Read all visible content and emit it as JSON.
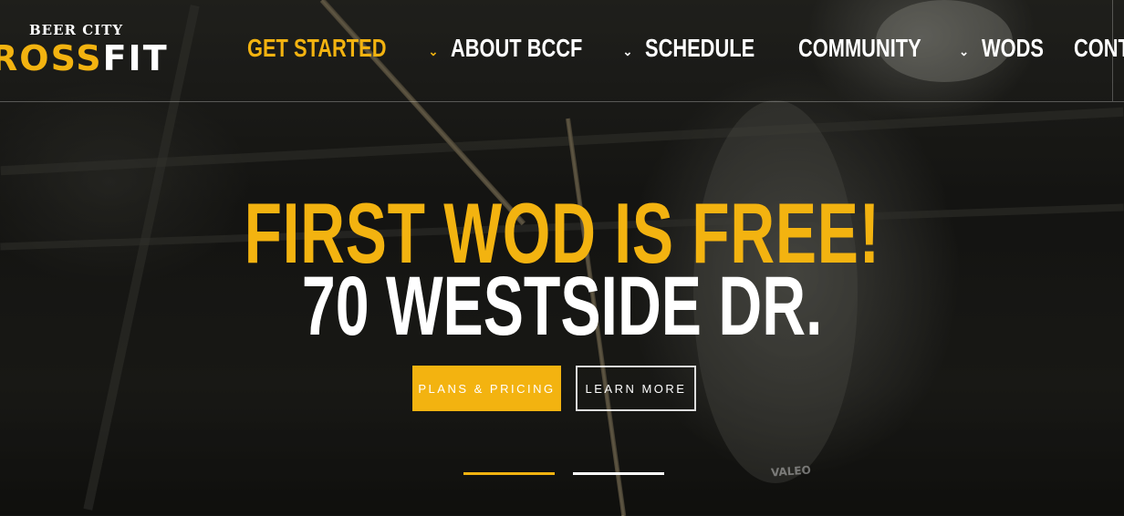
{
  "logo": {
    "top_text": "BEER CITY",
    "main_yellow": "ROSS",
    "main_white": "FIT",
    "icon": "barbell-skull-icon"
  },
  "nav": {
    "items": [
      {
        "label": "GET STARTED",
        "has_dropdown": true,
        "active": true
      },
      {
        "label": "ABOUT BCCF",
        "has_dropdown": true,
        "active": false
      },
      {
        "label": "SCHEDULE",
        "has_dropdown": false,
        "active": false
      },
      {
        "label": "COMMUNITY",
        "has_dropdown": true,
        "active": false
      },
      {
        "label": "WODS",
        "has_dropdown": false,
        "active": false
      },
      {
        "label": "CONTACT",
        "has_dropdown": false,
        "active": false
      }
    ],
    "caret": "⌄"
  },
  "hero": {
    "title": "FIRST WOD IS FREE!",
    "subtitle": "70 WESTSIDE DR.",
    "primary_button": "PLANS & PRICING",
    "secondary_button": "LEARN MORE",
    "slides": 2,
    "active_slide": 1,
    "background_text": "VALEO"
  },
  "colors": {
    "accent": "#f3b310",
    "text": "#ffffff",
    "background": "#141412"
  }
}
